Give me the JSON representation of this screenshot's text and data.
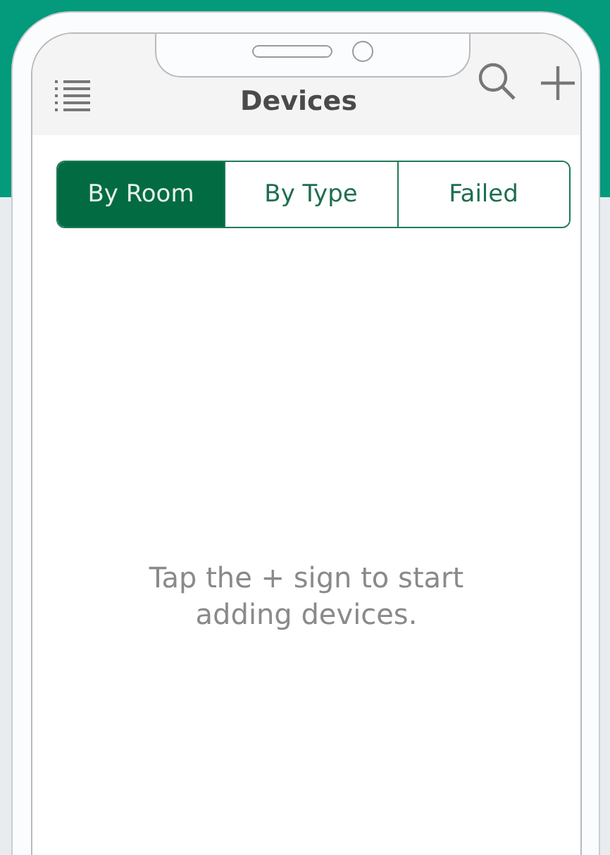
{
  "header": {
    "title": "Devices"
  },
  "tabs": [
    {
      "label": "By Room",
      "selected": true
    },
    {
      "label": "By Type",
      "selected": false
    },
    {
      "label": "Failed",
      "selected": false
    }
  ],
  "empty_message": "Tap the + sign to start adding devices."
}
